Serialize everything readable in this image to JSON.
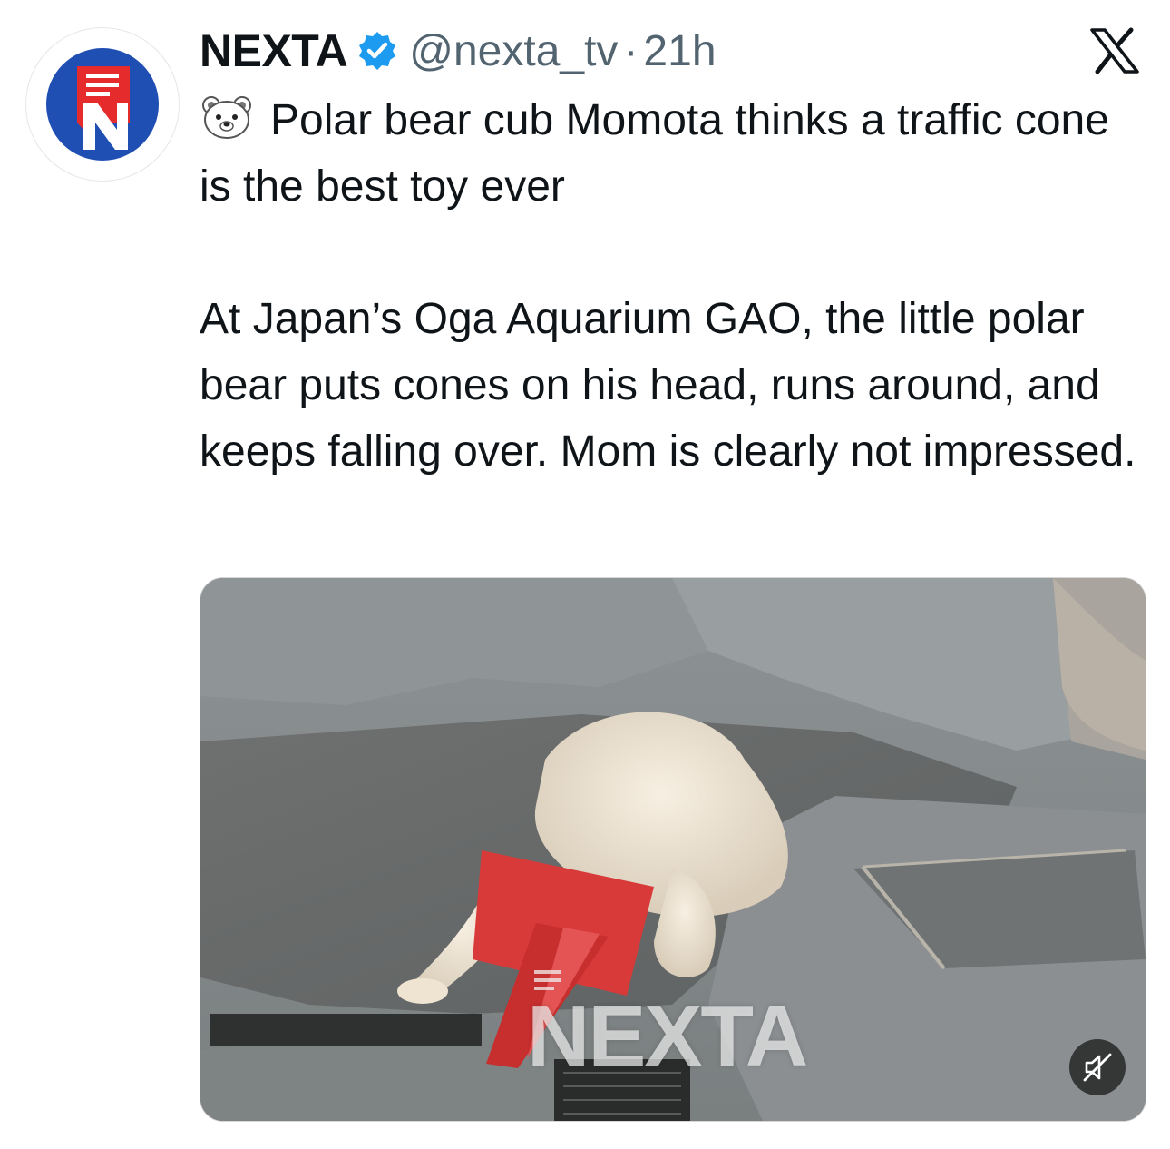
{
  "author": {
    "name": "NEXTA",
    "handle": "@nexta_tv",
    "separator": "·",
    "time": "21h",
    "verified": true,
    "avatar_letter": "N"
  },
  "brand": {
    "accent_blue": "#1d9bf0",
    "avatar_red": "#e52b2b",
    "avatar_blue": "#1f4fb3"
  },
  "tweet": {
    "emoji_icon": "polar-bear-emoji-icon",
    "line1": "Polar bear cub Momota thinks a traffic cone is the best toy ever",
    "line2": "At Japan’s Oga Aquarium GAO, the little polar bear puts cones on his head, runs around, and keeps falling over. Mom is clearly not impressed."
  },
  "media": {
    "type": "video",
    "watermark": "NEXTA",
    "muted": true,
    "mute_icon": "muted-speaker-icon"
  },
  "platform_icon": "x-logo-icon"
}
